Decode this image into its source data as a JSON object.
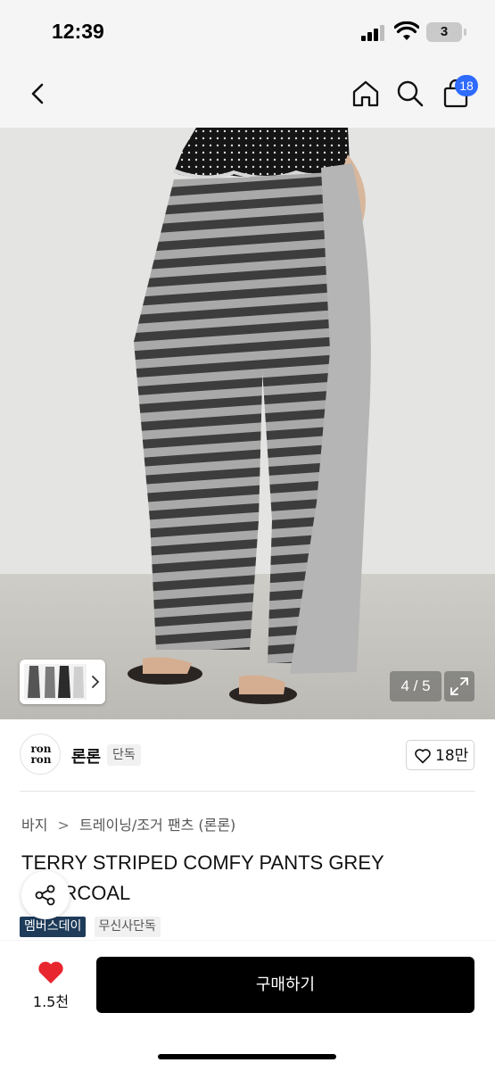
{
  "status_bar": {
    "time": "12:39",
    "battery": "3"
  },
  "nav": {
    "cart_count": "18"
  },
  "gallery": {
    "counter": "4 / 5"
  },
  "brand": {
    "logo_text_top": "ron",
    "logo_text_bottom": "ron",
    "name": "론론",
    "tag": "단독",
    "like_count": "18만"
  },
  "breadcrumb": {
    "category": "바지",
    "separator": ">",
    "subcategory": "트레이닝/조거 팬츠 (론론)"
  },
  "product": {
    "title": "TERRY STRIPED COMFY PANTS GREY CHARCOAL",
    "tags": [
      "멤버스데이",
      "무신사단독"
    ]
  },
  "bottom_bar": {
    "like_count": "1.5천",
    "buy_label": "구매하기"
  },
  "colors": {
    "accent_badge": "#2f6bff",
    "heart": "#e8262e",
    "buy_button": "#000000",
    "member_tag": "#1e3c5a"
  }
}
